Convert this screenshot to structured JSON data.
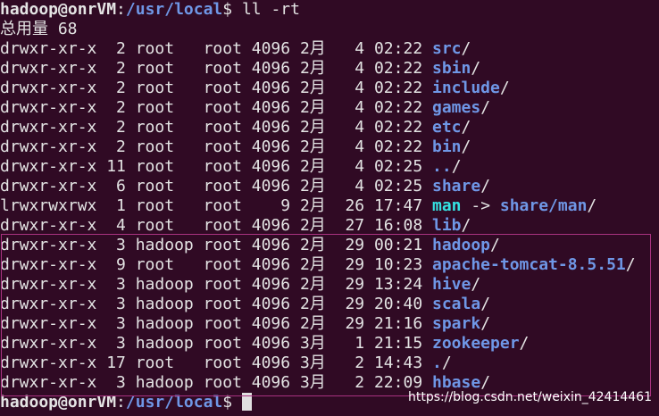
{
  "prompt": {
    "user_host": "hadoop@onrVM",
    "separator": ":",
    "cwd": "/usr/local",
    "symbol": "$",
    "command": " ll -rt"
  },
  "total_line": "总用量 68",
  "rows": [
    {
      "meta": "drwxr-xr-x  2 root   root 4096 2月   4 02:22 ",
      "name": "src",
      "suffix": "/",
      "type": "dir"
    },
    {
      "meta": "drwxr-xr-x  2 root   root 4096 2月   4 02:22 ",
      "name": "sbin",
      "suffix": "/",
      "type": "dir"
    },
    {
      "meta": "drwxr-xr-x  2 root   root 4096 2月   4 02:22 ",
      "name": "include",
      "suffix": "/",
      "type": "dir"
    },
    {
      "meta": "drwxr-xr-x  2 root   root 4096 2月   4 02:22 ",
      "name": "games",
      "suffix": "/",
      "type": "dir"
    },
    {
      "meta": "drwxr-xr-x  2 root   root 4096 2月   4 02:22 ",
      "name": "etc",
      "suffix": "/",
      "type": "dir"
    },
    {
      "meta": "drwxr-xr-x  2 root   root 4096 2月   4 02:22 ",
      "name": "bin",
      "suffix": "/",
      "type": "dir"
    },
    {
      "meta": "drwxr-xr-x 11 root   root 4096 2月   4 02:25 ",
      "name": "..",
      "suffix": "/",
      "type": "dir"
    },
    {
      "meta": "drwxr-xr-x  6 root   root 4096 2月   4 02:25 ",
      "name": "share",
      "suffix": "/",
      "type": "dir"
    },
    {
      "meta": "lrwxrwxrwx  1 root   root    9 2月  26 17:47 ",
      "name": "man",
      "arrow": " -> ",
      "target": "share/man",
      "suffix": "/",
      "type": "link"
    },
    {
      "meta": "drwxr-xr-x  4 root   root 4096 2月  27 16:08 ",
      "name": "lib",
      "suffix": "/",
      "type": "dir"
    },
    {
      "meta": "drwxr-xr-x  3 hadoop root 4096 2月  29 00:21 ",
      "name": "hadoop",
      "suffix": "/",
      "type": "dir"
    },
    {
      "meta": "drwxr-xr-x  9 root   root 4096 2月  29 10:23 ",
      "name": "apache-tomcat-8.5.51",
      "suffix": "/",
      "type": "dir"
    },
    {
      "meta": "drwxr-xr-x  3 hadoop root 4096 2月  29 13:24 ",
      "name": "hive",
      "suffix": "/",
      "type": "dir"
    },
    {
      "meta": "drwxr-xr-x  3 hadoop root 4096 2月  29 20:40 ",
      "name": "scala",
      "suffix": "/",
      "type": "dir"
    },
    {
      "meta": "drwxr-xr-x  3 hadoop root 4096 2月  29 21:16 ",
      "name": "spark",
      "suffix": "/",
      "type": "dir"
    },
    {
      "meta": "drwxr-xr-x  3 hadoop root 4096 3月   1 21:15 ",
      "name": "zookeeper",
      "suffix": "/",
      "type": "dir"
    },
    {
      "meta": "drwxr-xr-x 17 root   root 4096 3月   2 14:43 ",
      "name": ".",
      "suffix": "/",
      "type": "dir"
    },
    {
      "meta": "drwxr-xr-x  3 hadoop root 4096 3月   2 22:09 ",
      "name": "hbase",
      "suffix": "/",
      "type": "dir"
    }
  ],
  "final_prompt": {
    "user_host": "hadoop@onrVM",
    "separator": ":",
    "cwd": "/usr/local",
    "symbol": "$"
  },
  "watermark": "https://blog.csdn.net/weixin_42414461",
  "colors": {
    "background": "#300a24",
    "foreground": "#e4e4e4",
    "directory": "#6f97e6",
    "symlink": "#34e2e2",
    "highlight_border": "#a83280"
  }
}
